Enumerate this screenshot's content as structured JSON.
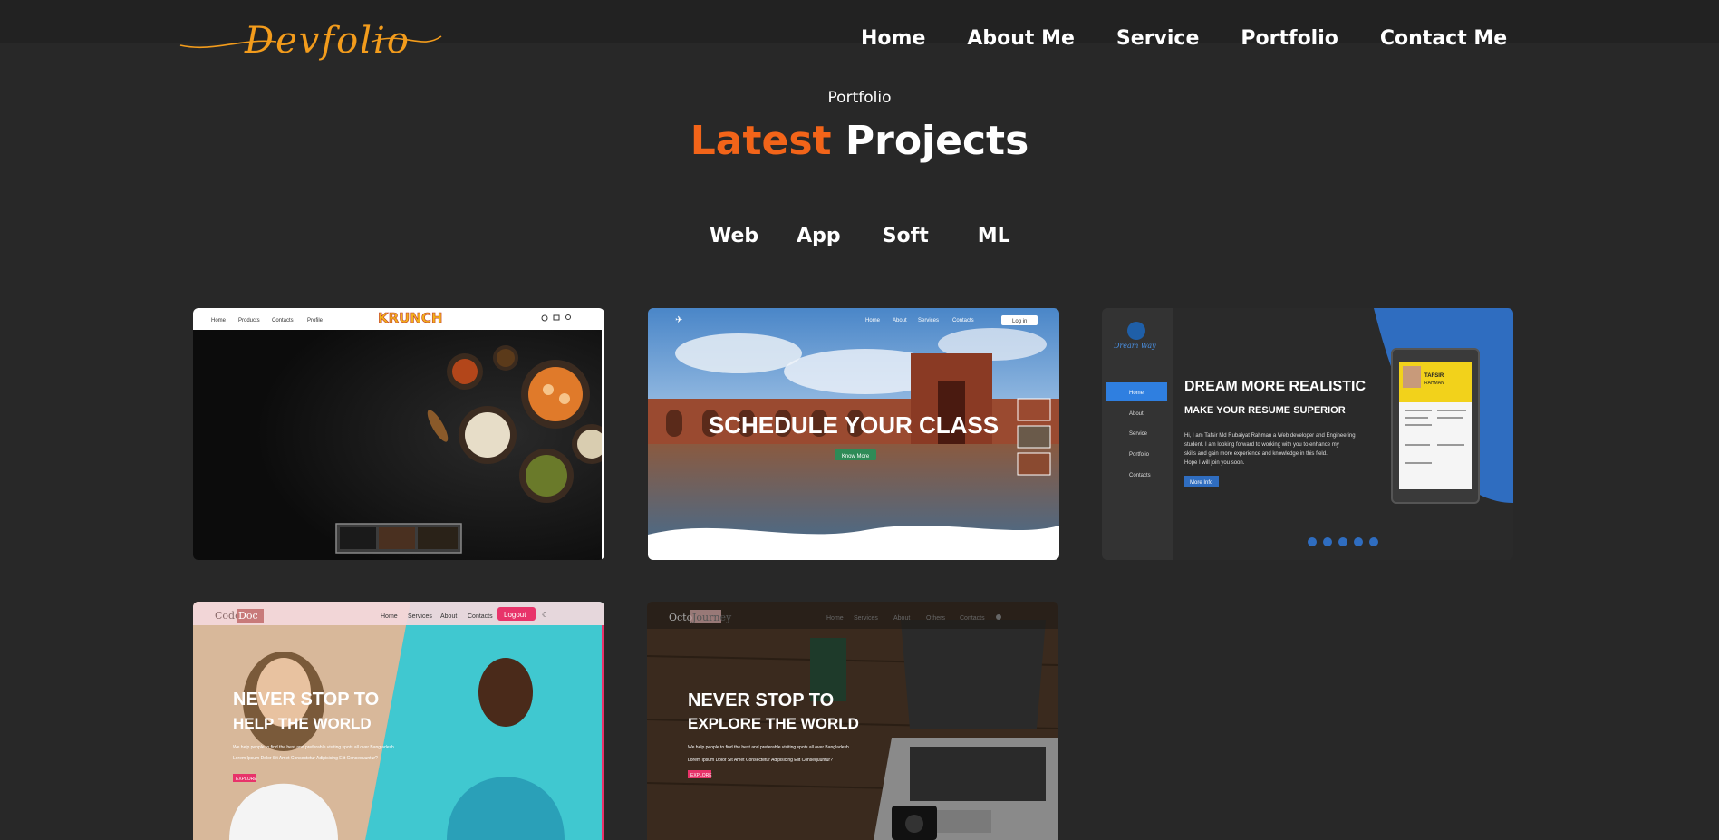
{
  "header": {
    "logo_text": "Devfolio",
    "nav": [
      "Home",
      "About Me",
      "Service",
      "Portfolio",
      "Contact Me"
    ]
  },
  "section": {
    "subtitle": "Portfolio",
    "title_accent": "Latest",
    "title_rest": "Projects",
    "filters": [
      "Web",
      "App",
      "Soft",
      "ML"
    ]
  },
  "projects": [
    {
      "nav": [
        "Home",
        "Products",
        "Contacts",
        "Profile"
      ],
      "brand": "KRUNCH"
    },
    {
      "nav": [
        "Home",
        "About",
        "Services",
        "Contacts"
      ],
      "login": "Log in",
      "headline": "SCHEDULE YOUR CLASS",
      "cta": "Know More"
    },
    {
      "brand": "Dream Way",
      "menu": [
        "Home",
        "About",
        "Service",
        "Portfolio",
        "Contacts"
      ],
      "headline": "DREAM MORE REALISTIC",
      "subheadline": "MAKE YOUR RESUME SUPERIOR",
      "body": [
        "Hi, I am Tafsir Md Rubaiyat Rahman a Web developer and Engineering",
        "student. I am looking forward to working with you to enhance my",
        "skills and gain more experience and knowledge in this field.",
        "Hope I will join you soon."
      ],
      "cta": "More Info",
      "resume_name": "TAFSIR",
      "resume_surname": "RAHMAN"
    },
    {
      "brand_a": "Code",
      "brand_b": "Doc",
      "nav": [
        "Home",
        "Services",
        "About",
        "Contacts"
      ],
      "logout": "Logout",
      "headline1": "NEVER STOP TO",
      "headline2": "HELP THE WORLD",
      "body1": "We help people to find the best and preferable visiting spots all over Bangladesh.",
      "body2": "Lorem Ipsum Dolor Sit Amet Consectetur Adipisicing Elit Consequuntur?",
      "cta": "EXPLORE"
    },
    {
      "brand_a": "Octo",
      "brand_b": "Journey",
      "nav": [
        "Home",
        "Services",
        "About",
        "Others",
        "Contacts"
      ],
      "headline1": "NEVER STOP TO",
      "headline2": "EXPLORE THE WORLD",
      "body1": "We help people to find the best and preferable visiting spots all over Bangladesh.",
      "body2": "Lorem Ipsum Dolor Sit Amet Consectetur Adipisicing Elit Consequuntur?",
      "cta": "EXPLORE"
    }
  ],
  "colors": {
    "background": "#282828",
    "accent": "#f26419",
    "logo": "#f39c1c"
  }
}
